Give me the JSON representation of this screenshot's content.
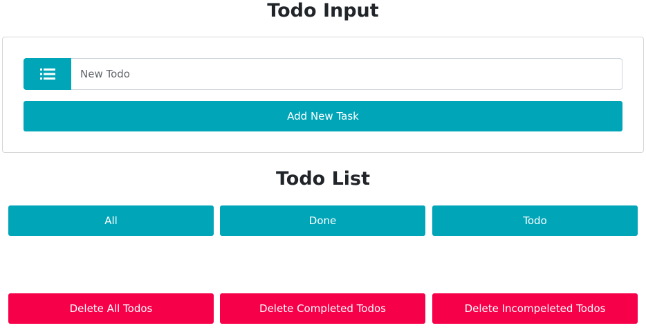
{
  "input_section": {
    "title": "Todo Input",
    "field_placeholder": "New Todo",
    "add_button_label": "Add New Task"
  },
  "list_section": {
    "title": "Todo List",
    "filters": [
      {
        "label": "All"
      },
      {
        "label": "Done"
      },
      {
        "label": "Todo"
      }
    ],
    "delete_actions": [
      {
        "label": "Delete All Todos"
      },
      {
        "label": "Delete Completed Todos"
      },
      {
        "label": "Delete Incompeleted Todos"
      }
    ]
  },
  "colors": {
    "primary": "#00a5b8",
    "danger": "#f7004a"
  },
  "icons": {
    "input_prefix": "list-icon"
  }
}
